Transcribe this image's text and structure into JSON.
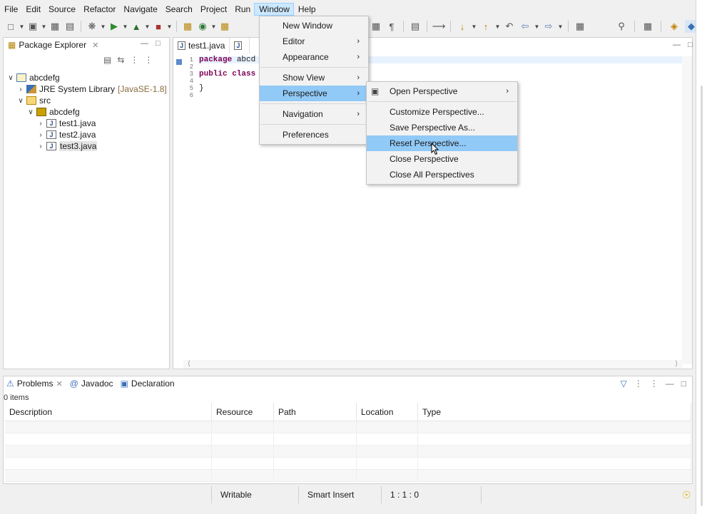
{
  "menubar": [
    "File",
    "Edit",
    "Source",
    "Refactor",
    "Navigate",
    "Search",
    "Project",
    "Run",
    "Window",
    "Help"
  ],
  "active_menu": "Window",
  "window_menu": {
    "items": [
      {
        "label": "New Window",
        "submenu": false
      },
      {
        "label": "Editor",
        "submenu": true
      },
      {
        "label": "Appearance",
        "submenu": true
      },
      {
        "separator": true
      },
      {
        "label": "Show View",
        "submenu": true
      },
      {
        "label": "Perspective",
        "submenu": true,
        "highlighted": true
      },
      {
        "separator": true
      },
      {
        "label": "Navigation",
        "submenu": true
      },
      {
        "separator": true
      },
      {
        "label": "Preferences",
        "submenu": false
      }
    ]
  },
  "perspective_menu": {
    "items": [
      {
        "label": "Open Perspective",
        "submenu": true,
        "icon": "open-perspective-icon"
      },
      {
        "separator": true
      },
      {
        "label": "Customize Perspective..."
      },
      {
        "label": "Save Perspective As..."
      },
      {
        "label": "Reset Perspective...",
        "highlighted": true
      },
      {
        "label": "Close Perspective"
      },
      {
        "label": "Close All Perspectives"
      }
    ]
  },
  "package_explorer": {
    "title": "Package Explorer",
    "tree": [
      {
        "label": "abcdefg",
        "level": 0,
        "expanded": true,
        "icon": "project"
      },
      {
        "label": "JRE System Library",
        "decoration": "[JavaSE-1.8]",
        "level": 1,
        "expanded": false,
        "icon": "lib"
      },
      {
        "label": "src",
        "level": 1,
        "expanded": true,
        "icon": "src"
      },
      {
        "label": "abcdefg",
        "level": 2,
        "expanded": true,
        "icon": "pkg"
      },
      {
        "label": "test1.java",
        "level": 3,
        "expanded": false,
        "icon": "java"
      },
      {
        "label": "test2.java",
        "level": 3,
        "expanded": false,
        "icon": "java"
      },
      {
        "label": "test3.java",
        "level": 3,
        "expanded": false,
        "icon": "java",
        "selected": true
      }
    ]
  },
  "editor": {
    "tabs": [
      "test1.java",
      ""
    ],
    "line_numbers": [
      "1",
      "2",
      "3",
      "4",
      "5",
      "6"
    ],
    "lines": [
      {
        "kw": "package",
        "rest": " abcd"
      },
      {
        "kw": "",
        "rest": ""
      },
      {
        "kw": "public class",
        "rest": ""
      },
      {
        "kw": "",
        "rest": ""
      },
      {
        "kw": "",
        "rest": "}"
      },
      {
        "kw": "",
        "rest": ""
      }
    ]
  },
  "problems": {
    "tabs": [
      {
        "label": "Problems",
        "icon": "problems-icon"
      },
      {
        "label": "Javadoc",
        "icon": "javadoc-icon"
      },
      {
        "label": "Declaration",
        "icon": "declaration-icon"
      }
    ],
    "count": "0 items",
    "columns": [
      "Description",
      "Resource",
      "Path",
      "Location",
      "Type"
    ],
    "rows": []
  },
  "statusbar": {
    "writable": "Writable",
    "insert_mode": "Smart Insert",
    "position": "1 : 1 : 0"
  }
}
